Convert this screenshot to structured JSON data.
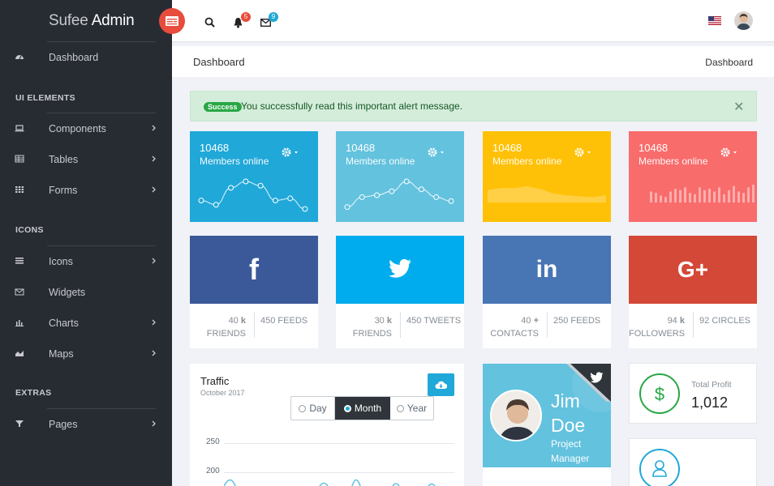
{
  "brand": {
    "part1": "Sufee",
    "part2": "Admin"
  },
  "sidebar": {
    "dashboard": "Dashboard",
    "sections": [
      "UI ELEMENTS",
      "ICONS",
      "EXTRAS"
    ],
    "items": [
      {
        "label": "Components",
        "icon": "laptop-icon"
      },
      {
        "label": "Tables",
        "icon": "table-icon"
      },
      {
        "label": "Forms",
        "icon": "grid-icon"
      },
      {
        "label": "Icons",
        "icon": "list-icon"
      },
      {
        "label": "Widgets",
        "icon": "envelope-icon"
      },
      {
        "label": "Charts",
        "icon": "bar-chart-icon"
      },
      {
        "label": "Maps",
        "icon": "area-chart-icon"
      },
      {
        "label": "Pages",
        "icon": "filter-icon"
      }
    ]
  },
  "header": {
    "notif_count": "5",
    "mail_count": "9"
  },
  "breadcrumb": {
    "title": "Dashboard",
    "trail": "Dashboard"
  },
  "alert": {
    "badge": "Success",
    "message": "You successfully read this important alert message."
  },
  "stats": [
    {
      "value": "10468",
      "label": "Members online",
      "color": "#20a8d8",
      "chart": "line",
      "points": [
        8,
        4,
        20,
        26,
        22,
        8,
        10,
        0
      ]
    },
    {
      "value": "10468",
      "label": "Members online",
      "color": "#63c2de",
      "chart": "line",
      "points": [
        2,
        12,
        14,
        18,
        28,
        20,
        12,
        8
      ]
    },
    {
      "value": "10468",
      "label": "Members online",
      "color": "#ffc107",
      "chart": "area",
      "points": [
        14,
        16,
        16,
        18,
        15,
        10,
        8,
        7,
        6,
        8
      ]
    },
    {
      "value": "10468",
      "label": "Members online",
      "color": "#f86c6b",
      "chart": "bar",
      "points": [
        16,
        14,
        10,
        8,
        16,
        20,
        18,
        22,
        14,
        12,
        22,
        18,
        20,
        16,
        22,
        12,
        18,
        24,
        16,
        14,
        22,
        26
      ]
    }
  ],
  "social": [
    {
      "name": "facebook",
      "glyph": "f",
      "color": "#3b5998",
      "v1": "40",
      "u1": "k",
      "l1": "FRIENDS",
      "v2": "450",
      "l2": "FEEDS"
    },
    {
      "name": "twitter",
      "glyph": "tw",
      "color": "#00aced",
      "v1": "30",
      "u1": "k",
      "l1": "FRIENDS",
      "v2": "450",
      "l2": "TWEETS"
    },
    {
      "name": "linkedin",
      "glyph": "in",
      "color": "#4875b4",
      "v1": "40",
      "u1": "+",
      "l1": "CONTACTS",
      "v2": "250",
      "l2": "FEEDS"
    },
    {
      "name": "google-plus",
      "glyph": "G+",
      "color": "#d34836",
      "v1": "94",
      "u1": "k",
      "l1": "FOLLOWERS",
      "v2": "92",
      "l2": "CIRCLES"
    }
  ],
  "traffic": {
    "title": "Traffic",
    "subtitle": "October 2017",
    "options": [
      "Day",
      "Month",
      "Year"
    ],
    "selected": "Month",
    "yticks": [
      "250",
      "200"
    ]
  },
  "profile": {
    "first": "Jim",
    "last": "Doe",
    "role_line1": "Project",
    "role_line2": "Manager"
  },
  "profit": {
    "label": "Total Profit",
    "value": "1,012"
  }
}
